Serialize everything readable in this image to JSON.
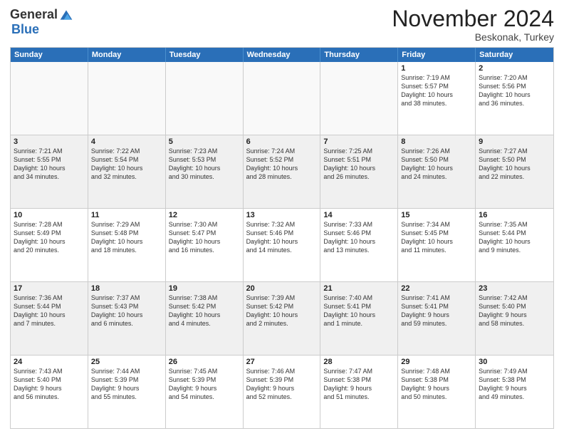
{
  "logo": {
    "general": "General",
    "blue": "Blue"
  },
  "header": {
    "month": "November 2024",
    "location": "Beskonak, Turkey"
  },
  "days_of_week": [
    "Sunday",
    "Monday",
    "Tuesday",
    "Wednesday",
    "Thursday",
    "Friday",
    "Saturday"
  ],
  "weeks": [
    [
      {
        "day": "",
        "info": ""
      },
      {
        "day": "",
        "info": ""
      },
      {
        "day": "",
        "info": ""
      },
      {
        "day": "",
        "info": ""
      },
      {
        "day": "",
        "info": ""
      },
      {
        "day": "1",
        "info": "Sunrise: 7:19 AM\nSunset: 5:57 PM\nDaylight: 10 hours\nand 38 minutes."
      },
      {
        "day": "2",
        "info": "Sunrise: 7:20 AM\nSunset: 5:56 PM\nDaylight: 10 hours\nand 36 minutes."
      }
    ],
    [
      {
        "day": "3",
        "info": "Sunrise: 7:21 AM\nSunset: 5:55 PM\nDaylight: 10 hours\nand 34 minutes."
      },
      {
        "day": "4",
        "info": "Sunrise: 7:22 AM\nSunset: 5:54 PM\nDaylight: 10 hours\nand 32 minutes."
      },
      {
        "day": "5",
        "info": "Sunrise: 7:23 AM\nSunset: 5:53 PM\nDaylight: 10 hours\nand 30 minutes."
      },
      {
        "day": "6",
        "info": "Sunrise: 7:24 AM\nSunset: 5:52 PM\nDaylight: 10 hours\nand 28 minutes."
      },
      {
        "day": "7",
        "info": "Sunrise: 7:25 AM\nSunset: 5:51 PM\nDaylight: 10 hours\nand 26 minutes."
      },
      {
        "day": "8",
        "info": "Sunrise: 7:26 AM\nSunset: 5:50 PM\nDaylight: 10 hours\nand 24 minutes."
      },
      {
        "day": "9",
        "info": "Sunrise: 7:27 AM\nSunset: 5:50 PM\nDaylight: 10 hours\nand 22 minutes."
      }
    ],
    [
      {
        "day": "10",
        "info": "Sunrise: 7:28 AM\nSunset: 5:49 PM\nDaylight: 10 hours\nand 20 minutes."
      },
      {
        "day": "11",
        "info": "Sunrise: 7:29 AM\nSunset: 5:48 PM\nDaylight: 10 hours\nand 18 minutes."
      },
      {
        "day": "12",
        "info": "Sunrise: 7:30 AM\nSunset: 5:47 PM\nDaylight: 10 hours\nand 16 minutes."
      },
      {
        "day": "13",
        "info": "Sunrise: 7:32 AM\nSunset: 5:46 PM\nDaylight: 10 hours\nand 14 minutes."
      },
      {
        "day": "14",
        "info": "Sunrise: 7:33 AM\nSunset: 5:46 PM\nDaylight: 10 hours\nand 13 minutes."
      },
      {
        "day": "15",
        "info": "Sunrise: 7:34 AM\nSunset: 5:45 PM\nDaylight: 10 hours\nand 11 minutes."
      },
      {
        "day": "16",
        "info": "Sunrise: 7:35 AM\nSunset: 5:44 PM\nDaylight: 10 hours\nand 9 minutes."
      }
    ],
    [
      {
        "day": "17",
        "info": "Sunrise: 7:36 AM\nSunset: 5:44 PM\nDaylight: 10 hours\nand 7 minutes."
      },
      {
        "day": "18",
        "info": "Sunrise: 7:37 AM\nSunset: 5:43 PM\nDaylight: 10 hours\nand 6 minutes."
      },
      {
        "day": "19",
        "info": "Sunrise: 7:38 AM\nSunset: 5:42 PM\nDaylight: 10 hours\nand 4 minutes."
      },
      {
        "day": "20",
        "info": "Sunrise: 7:39 AM\nSunset: 5:42 PM\nDaylight: 10 hours\nand 2 minutes."
      },
      {
        "day": "21",
        "info": "Sunrise: 7:40 AM\nSunset: 5:41 PM\nDaylight: 10 hours\nand 1 minute."
      },
      {
        "day": "22",
        "info": "Sunrise: 7:41 AM\nSunset: 5:41 PM\nDaylight: 9 hours\nand 59 minutes."
      },
      {
        "day": "23",
        "info": "Sunrise: 7:42 AM\nSunset: 5:40 PM\nDaylight: 9 hours\nand 58 minutes."
      }
    ],
    [
      {
        "day": "24",
        "info": "Sunrise: 7:43 AM\nSunset: 5:40 PM\nDaylight: 9 hours\nand 56 minutes."
      },
      {
        "day": "25",
        "info": "Sunrise: 7:44 AM\nSunset: 5:39 PM\nDaylight: 9 hours\nand 55 minutes."
      },
      {
        "day": "26",
        "info": "Sunrise: 7:45 AM\nSunset: 5:39 PM\nDaylight: 9 hours\nand 54 minutes."
      },
      {
        "day": "27",
        "info": "Sunrise: 7:46 AM\nSunset: 5:39 PM\nDaylight: 9 hours\nand 52 minutes."
      },
      {
        "day": "28",
        "info": "Sunrise: 7:47 AM\nSunset: 5:38 PM\nDaylight: 9 hours\nand 51 minutes."
      },
      {
        "day": "29",
        "info": "Sunrise: 7:48 AM\nSunset: 5:38 PM\nDaylight: 9 hours\nand 50 minutes."
      },
      {
        "day": "30",
        "info": "Sunrise: 7:49 AM\nSunset: 5:38 PM\nDaylight: 9 hours\nand 49 minutes."
      }
    ]
  ]
}
